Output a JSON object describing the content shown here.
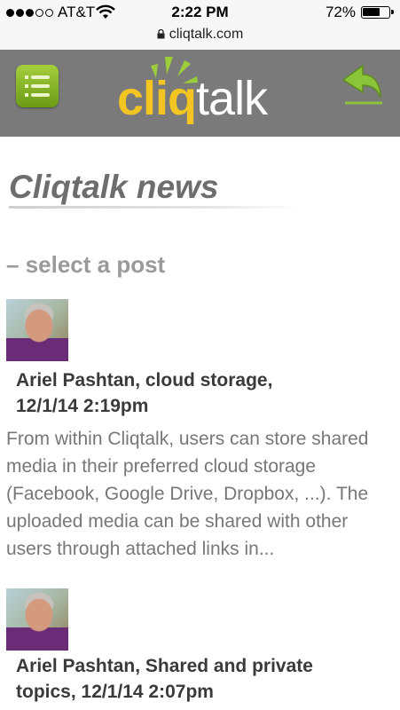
{
  "status_bar": {
    "carrier": "AT&T",
    "time": "2:22 PM",
    "battery_percent": "72%",
    "battery_level": 0.72,
    "signal_dots_filled": 3,
    "signal_dots_total": 5
  },
  "browser": {
    "url": "cliqtalk.com"
  },
  "header": {
    "logo_part1": "cliq",
    "logo_part2": "talk",
    "menu_icon": "list-menu-icon",
    "back_icon": "back-arrow-icon",
    "colors": {
      "bar": "#7a7a7a",
      "accent_green": "#8bbb2a",
      "logo_yellow": "#f2c522"
    }
  },
  "main": {
    "title": "Cliqtalk news",
    "subtitle": "– select a post",
    "posts": [
      {
        "heading_line1": "Ariel Pashtan, cloud storage,",
        "heading_line2": "12/1/14 2:19pm",
        "body": " From within Cliqtalk, users can store shared media in their preferred cloud storage (Facebook, Google Drive, Dropbox, ...). The uploaded media can be shared with other users through attached links in..."
      },
      {
        "heading_line1": "Ariel Pashtan, Shared and private",
        "heading_line2": "topics,  12/1/14 2:07pm"
      }
    ]
  }
}
